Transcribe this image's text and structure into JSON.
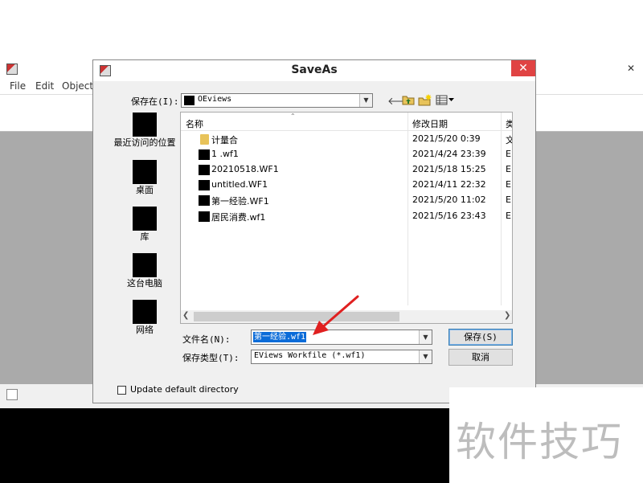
{
  "app": {
    "menu": [
      "File",
      "Edit",
      "Object"
    ]
  },
  "dialog": {
    "title": "SaveAs",
    "close_glyph": "✕",
    "save_in_label": "保存在(I):",
    "save_in_value": "OEviews",
    "places": [
      "最近访问的位置",
      "桌面",
      "库",
      "这台电脑",
      "网络"
    ],
    "columns": {
      "name": "名称",
      "date": "修改日期",
      "type": "类"
    },
    "files": [
      {
        "icon": "folder-icon",
        "name": "计量合",
        "date": "2021/5/20 0:39",
        "type": "文"
      },
      {
        "icon": "file-icon",
        "name": "1 .wf1",
        "date": "2021/4/24 23:39",
        "type": "E"
      },
      {
        "icon": "file-icon",
        "name": "20210518.WF1",
        "date": "2021/5/18 15:25",
        "type": "E"
      },
      {
        "icon": "file-icon",
        "name": "untitled.WF1",
        "date": "2021/4/11 22:32",
        "type": "E"
      },
      {
        "icon": "file-icon",
        "name": "第一经验.WF1",
        "date": "2021/5/20 11:02",
        "type": "E"
      },
      {
        "icon": "file-icon",
        "name": "居民消费.wf1",
        "date": "2021/5/16 23:43",
        "type": "E"
      }
    ],
    "filename_label": "文件名(N):",
    "filename_value": "第一经验.wf1",
    "filetype_label": "保存类型(T):",
    "filetype_value": "EViews Workfile (*.wf1)",
    "save_button": "保存(S)",
    "cancel_button": "取消",
    "checkbox_label": "Update default directory"
  },
  "watermark": "软件技巧",
  "colors": {
    "close": "#e04343",
    "selection": "#0a6bd8",
    "arrow": "#e02020"
  }
}
